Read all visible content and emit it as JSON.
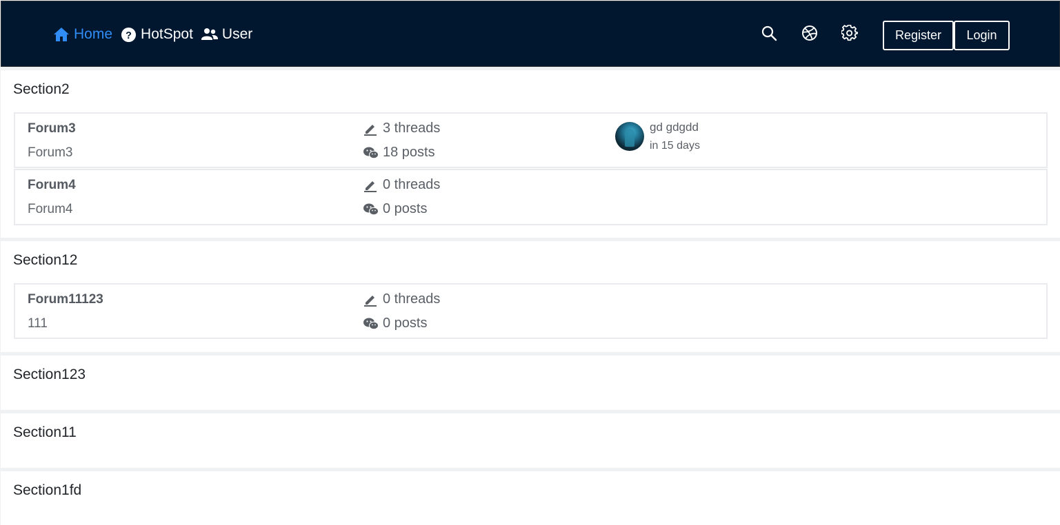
{
  "nav": {
    "links": [
      {
        "label": "Home",
        "icon": "home-icon"
      },
      {
        "label": "HotSpot",
        "icon": "question-circle-icon"
      },
      {
        "label": "User",
        "icon": "users-icon"
      }
    ],
    "icons": [
      "search-icon",
      "dribbble-icon",
      "gear-icon"
    ],
    "register_label": "Register",
    "login_label": "Login",
    "colors": {
      "background": "#00172f",
      "active": "#2f8df5"
    }
  },
  "sections": [
    {
      "title": "Section2",
      "forums": [
        {
          "name": "Forum3",
          "description": "Forum3",
          "threads": "3 threads",
          "posts": "18 posts",
          "last_post": {
            "user": "gd gdgdd",
            "time": "in 15 days"
          }
        },
        {
          "name": "Forum4",
          "description": "Forum4",
          "threads": "0 threads",
          "posts": "0 posts"
        }
      ]
    },
    {
      "title": "Section12",
      "forums": [
        {
          "name": "Forum11123",
          "description": "111",
          "threads": "0 threads",
          "posts": "0 posts"
        }
      ]
    },
    {
      "title": "Section123",
      "forums": []
    },
    {
      "title": "Section11",
      "forums": []
    },
    {
      "title": "Section1fd",
      "forums": []
    }
  ]
}
